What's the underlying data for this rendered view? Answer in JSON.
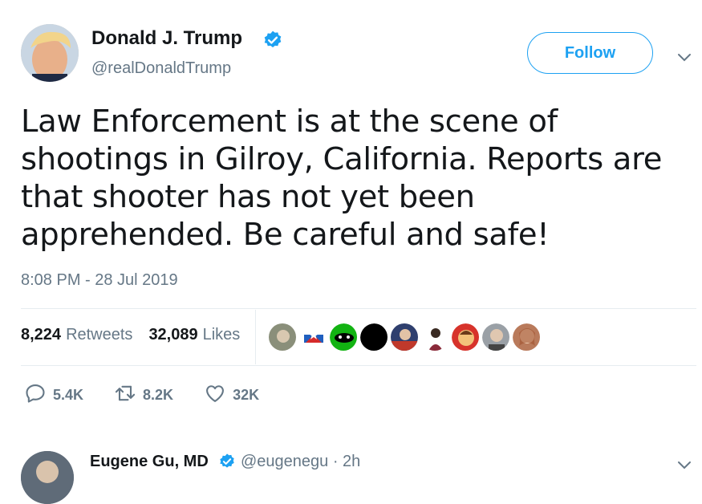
{
  "tweet": {
    "author_name": "Donald J. Trump",
    "author_handle": "@realDonaldTrump",
    "follow_label": "Follow",
    "text": "Law Enforcement is at the scene of shootings in Gilroy, California. Reports are that shooter has not yet been apprehended. Be careful and safe!",
    "timestamp": "8:08 PM - 28 Jul 2019",
    "stats": {
      "retweets_count": "8,224",
      "retweets_label": "Retweets",
      "likes_count": "32,089",
      "likes_label": "Likes"
    },
    "actions": {
      "reply_count": "5.4K",
      "retweet_count": "8.2K",
      "like_count": "32K"
    }
  },
  "reply_preview": {
    "author_name": "Eugene Gu, MD",
    "author_handle": "@eugenegu · 2h"
  },
  "colors": {
    "accent": "#1da1f2",
    "secondary_text": "#657786",
    "divider": "#e6ecf0"
  },
  "icons": [
    "verified-badge-icon",
    "chevron-down-icon",
    "reply-icon",
    "retweet-icon",
    "like-icon"
  ]
}
